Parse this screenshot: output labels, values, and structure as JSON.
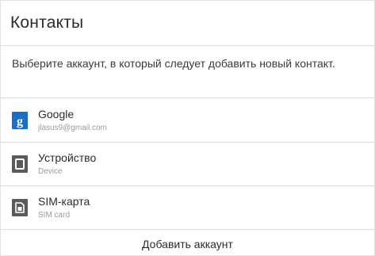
{
  "dialog": {
    "title": "Контакты",
    "message": "Выберите аккаунт, в который следует добавить новый контакт."
  },
  "accounts": [
    {
      "name": "Google",
      "subtitle": "jlasus9@gmail.com",
      "icon": "google-icon",
      "color": "#1a6fc4"
    },
    {
      "name": "Устройство",
      "subtitle": "Device",
      "icon": "device-icon",
      "color": "#5a5a5a"
    },
    {
      "name": "SIM-карта",
      "subtitle": "SIM card",
      "icon": "sim-card-icon",
      "color": "#5a5a5a"
    }
  ],
  "footer": {
    "add_account_label": "Добавить аккаунт"
  }
}
